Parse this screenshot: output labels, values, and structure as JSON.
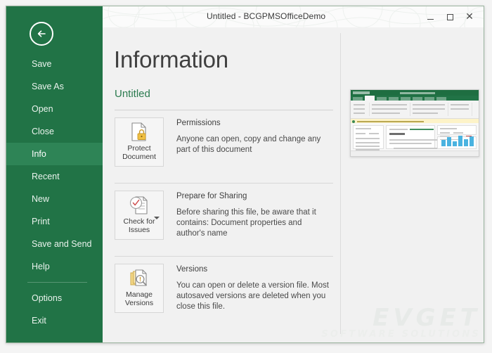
{
  "window": {
    "title": "Untitled - BCGPMSOfficeDemo",
    "controls": {
      "minimize": "Minimize",
      "maximize": "Maximize",
      "close": "Close"
    },
    "accent_color": "#217346",
    "accent_active_color": "#2e8456"
  },
  "sidebar": {
    "back_label": "Back",
    "items": [
      {
        "label": "Save",
        "active": false
      },
      {
        "label": "Save As",
        "active": false
      },
      {
        "label": "Open",
        "active": false
      },
      {
        "label": "Close",
        "active": false
      },
      {
        "label": "Info",
        "active": true
      },
      {
        "label": "Recent",
        "active": false
      },
      {
        "label": "New",
        "active": false
      },
      {
        "label": "Print",
        "active": false
      },
      {
        "label": "Save and Send",
        "active": false
      },
      {
        "label": "Help",
        "active": false
      },
      {
        "label": "Options",
        "active": false
      },
      {
        "label": "Exit",
        "active": false
      }
    ]
  },
  "main": {
    "page_title": "Information",
    "document_name": "Untitled",
    "document_name_color": "#2b7b4f",
    "sections": [
      {
        "button_label_line1": "Protect",
        "button_label_line2": "Document",
        "icon": "document-lock-icon",
        "has_dropdown": false,
        "heading": "Permissions",
        "description": "Anyone can open, copy and change any part of this document"
      },
      {
        "button_label_line1": "Check for",
        "button_label_line2": "Issues",
        "icon": "document-inspect-icon",
        "has_dropdown": true,
        "heading": "Prepare for Sharing",
        "description": "Before sharing this file, be aware that it contains: Document properties and  author's name"
      },
      {
        "button_label_line1": "Manage",
        "button_label_line2": "Versions",
        "icon": "document-stack-search-icon",
        "has_dropdown": false,
        "heading": "Versions",
        "description": "You can open or delete a version file. Most autosaved versions are deleted when you close this file."
      }
    ]
  },
  "preview": {
    "name": "document-preview-thumbnail"
  },
  "watermark": {
    "main": "EVGET",
    "sub": "SOFTWARE SOLUTIONS"
  }
}
